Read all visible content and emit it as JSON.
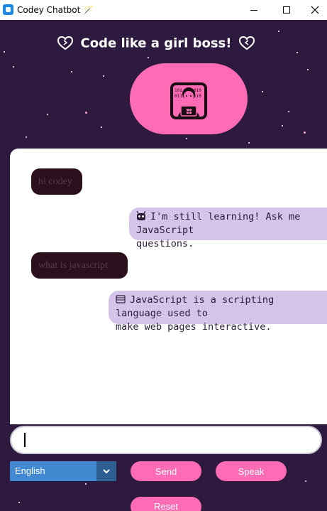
{
  "window": {
    "title": "Codey Chatbot 🪄",
    "icon": "app-icon",
    "controls": [
      "minimize-icon",
      "maximize-icon",
      "close-icon"
    ]
  },
  "header": {
    "title": "Code like a girl boss!",
    "left_icon": "heart-icon",
    "right_icon": "heart-icon",
    "avatar_icon": "coder-girl-icon"
  },
  "chat": {
    "messages": [
      {
        "role": "user",
        "text": "hi codey"
      },
      {
        "role": "bot",
        "icon": "robot-icon",
        "text": "I'm still learning! Ask me JavaScript",
        "text2": "questions."
      },
      {
        "role": "user",
        "text": "what is javascript"
      },
      {
        "role": "bot",
        "icon": "book-icon",
        "text": "JavaScript is a scripting language used to",
        "text2": "make web pages interactive."
      }
    ]
  },
  "input": {
    "value": "",
    "placeholder": ""
  },
  "controls": {
    "language": "English",
    "send_label": "Send",
    "speak_label": "Speak",
    "reset_label": "Reset"
  },
  "colors": {
    "background": "#2e1a3f",
    "accent_pink": "#ff6bb5",
    "user_bubble": "#2c0f1c",
    "bot_bubble": "#d4c4ea",
    "select_blue": "#4289d1"
  }
}
